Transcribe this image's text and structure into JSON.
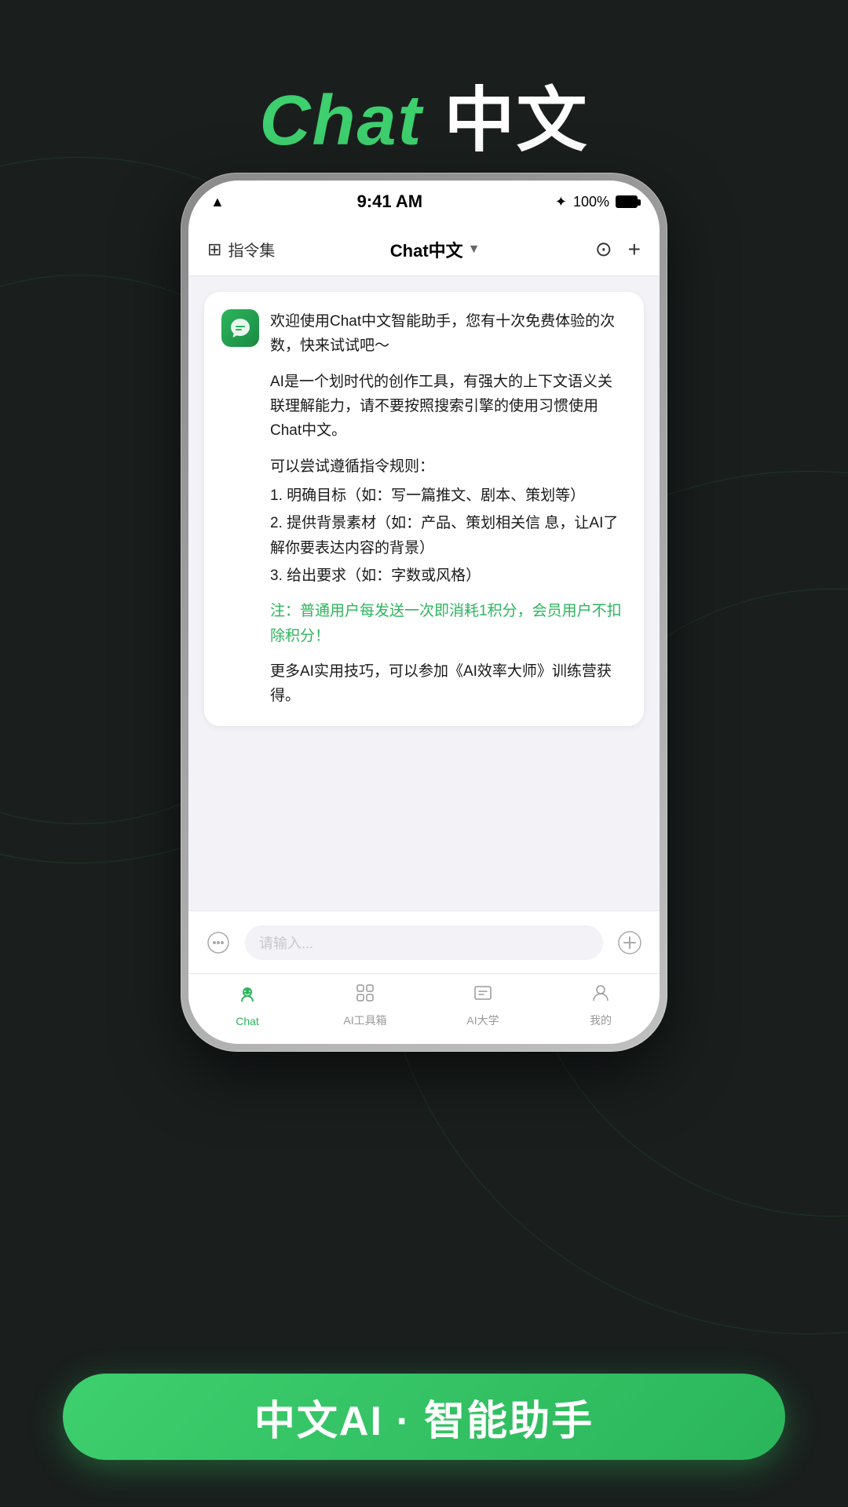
{
  "page": {
    "background_color": "#1a1f1e"
  },
  "header": {
    "title_chat": "Chat",
    "title_chinese": "中文"
  },
  "status_bar": {
    "time": "9:41 AM",
    "battery_percent": "100%",
    "wifi": "▲",
    "bluetooth": "✦"
  },
  "nav": {
    "left_icon": "⊞",
    "left_label": "指令集",
    "center_title": "Chat中文",
    "dropdown_icon": "▼",
    "history_icon": "⊙",
    "add_icon": "+"
  },
  "message": {
    "intro_line1": "欢迎使用Chat中文智能助手，您有十次免费体验的次数，快来试试吧～",
    "body_line1": "AI是一个划时代的创作工具，有强大的上下文语义关联理解能力，请不要按照搜索引擎的使用习惯使用Chat中文。",
    "body_line2": "可以尝试遵循指令规则：",
    "body_line3": "1. 明确目标（如：写一篇推文、剧本、策划等）",
    "body_line4": "2.  提供背景素材（如：产品、策划相关信  息，让AI了解你要表达内容的背景）",
    "body_line5": "3. 给出要求（如：字数或风格）",
    "notice": "注：普通用户每发送一次即消耗1积分，会员用户不扣除积分！",
    "footer": "更多AI实用技巧，可以参加《AI效率大师》训练营获得。"
  },
  "input": {
    "placeholder": "请输入...",
    "mic_icon": "◉",
    "plus_icon": "⊕"
  },
  "tabs": [
    {
      "label": "Chat",
      "icon": "☻",
      "active": true
    },
    {
      "label": "AI工具箱",
      "icon": "⊕",
      "active": false
    },
    {
      "label": "AI大学",
      "icon": "⊡",
      "active": false
    },
    {
      "label": "我的",
      "icon": "☺",
      "active": false
    }
  ],
  "cta": {
    "text": "中文AI · 智能助手"
  }
}
